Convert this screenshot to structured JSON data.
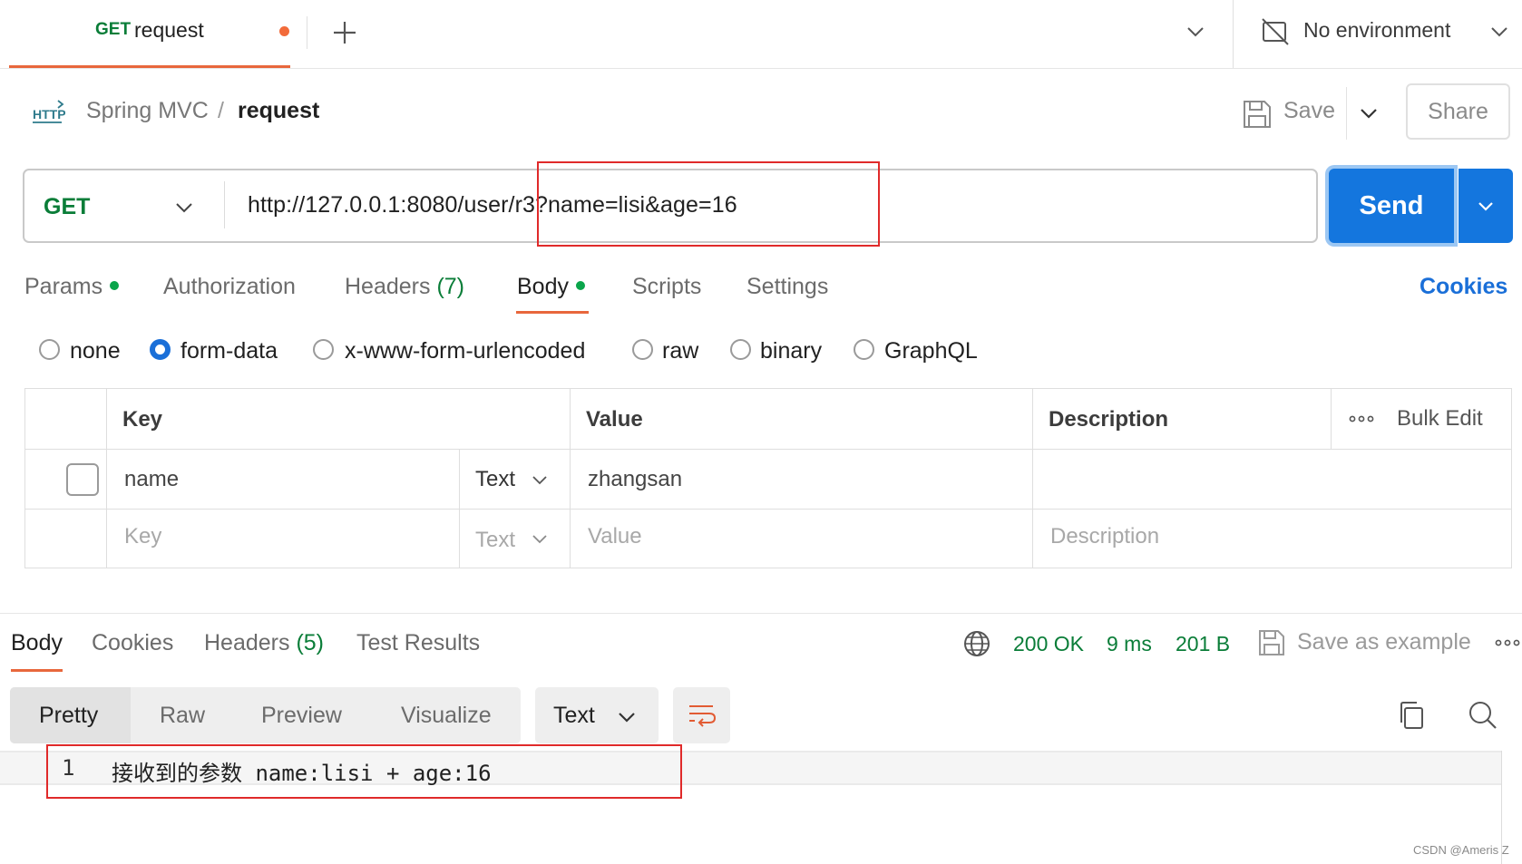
{
  "tab": {
    "method": "GET",
    "name": "request"
  },
  "environment": {
    "label": "No environment"
  },
  "breadcrumb": {
    "icon": "HTTP",
    "parent": "Spring MVC",
    "separator": "/",
    "current": "request"
  },
  "toolbar": {
    "save_label": "Save",
    "share_label": "Share"
  },
  "request": {
    "method": "GET",
    "url": "http://127.0.0.1:8080/user/r3?name=lisi&age=16",
    "send_label": "Send"
  },
  "request_tabs": [
    {
      "label": "Params",
      "dot": true
    },
    {
      "label": "Authorization"
    },
    {
      "label": "Headers",
      "count": "(7)"
    },
    {
      "label": "Body",
      "dot": true,
      "active": true
    },
    {
      "label": "Scripts"
    },
    {
      "label": "Settings"
    }
  ],
  "cookies_link": "Cookies",
  "body_modes": [
    {
      "label": "none",
      "selected": false
    },
    {
      "label": "form-data",
      "selected": true
    },
    {
      "label": "x-www-form-urlencoded",
      "selected": false
    },
    {
      "label": "raw",
      "selected": false
    },
    {
      "label": "binary",
      "selected": false
    },
    {
      "label": "GraphQL",
      "selected": false
    }
  ],
  "table": {
    "headers": {
      "key": "Key",
      "value": "Value",
      "description": "Description",
      "bulk_edit": "Bulk Edit"
    },
    "rows": [
      {
        "key": "name",
        "type": "Text",
        "value": "zhangsan",
        "description": ""
      }
    ],
    "placeholder": {
      "key": "Key",
      "type": "Text",
      "value": "Value",
      "description": "Description"
    }
  },
  "response_tabs": [
    {
      "label": "Body",
      "active": true
    },
    {
      "label": "Cookies"
    },
    {
      "label": "Headers",
      "count": "(5)"
    },
    {
      "label": "Test Results"
    }
  ],
  "response_status": {
    "code": "200 OK",
    "time": "9 ms",
    "size": "201 B"
  },
  "save_as_example": "Save as example",
  "view_modes": [
    "Pretty",
    "Raw",
    "Preview",
    "Visualize"
  ],
  "format": "Text",
  "code_lines": [
    {
      "number": "1",
      "text": "接收到的参数 name:lisi + age:16"
    }
  ],
  "watermark": "CSDN @Ameris Z",
  "colors": {
    "accent": "#e8673c",
    "primary": "#1476de",
    "method_green": "#0a7d38",
    "highlight": "#e02a2a"
  }
}
